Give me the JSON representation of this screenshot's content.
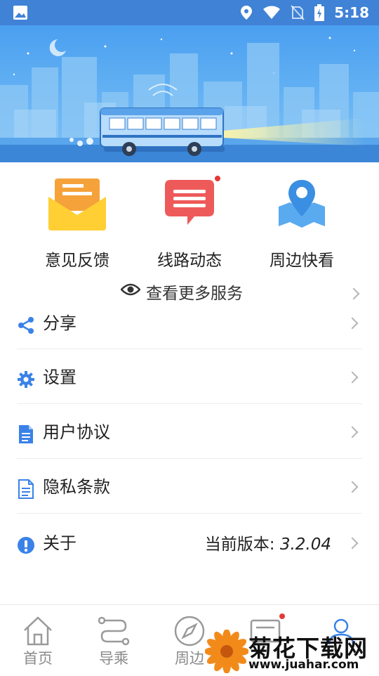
{
  "status_bar": {
    "time": "5:18",
    "icons": [
      "image-icon",
      "location-icon",
      "wifi-icon",
      "no-sim-icon",
      "battery-icon"
    ]
  },
  "services": [
    {
      "label": "意见反馈",
      "icon": "envelope-icon",
      "has_badge": false
    },
    {
      "label": "线路动态",
      "icon": "message-icon",
      "has_badge": true
    },
    {
      "label": "周边快看",
      "icon": "map-pin-icon",
      "has_badge": false
    }
  ],
  "more_services": {
    "label": "查看更多服务",
    "icon": "eye-icon"
  },
  "menu": [
    {
      "label": "分享",
      "icon": "share-icon"
    },
    {
      "label": "设置",
      "icon": "gear-icon"
    },
    {
      "label": "用户协议",
      "icon": "document-icon"
    },
    {
      "label": "隐私条款",
      "icon": "document-outline-icon"
    },
    {
      "label": "关于",
      "icon": "info-icon",
      "value_prefix": "当前版本: ",
      "value": "3.2.04"
    }
  ],
  "tabbar": [
    {
      "label": "首页",
      "icon": "home-icon"
    },
    {
      "label": "导乘",
      "icon": "route-icon"
    },
    {
      "label": "周边",
      "icon": "compass-icon"
    },
    {
      "label": "",
      "icon": "message-icon",
      "has_badge": true
    },
    {
      "label": "",
      "icon": "profile-icon"
    }
  ],
  "watermark": {
    "title": "菊花下载网",
    "url": "www.juahar.com"
  },
  "colors": {
    "status_bar": "#3f82d6",
    "accent_blue": "#3a82e8",
    "badge_red": "#e53935",
    "envelope_yellow": "#ffcf33",
    "envelope_orange": "#f5a23a",
    "message_red": "#ee5a5a",
    "map_blue": "#5aaaf0"
  }
}
